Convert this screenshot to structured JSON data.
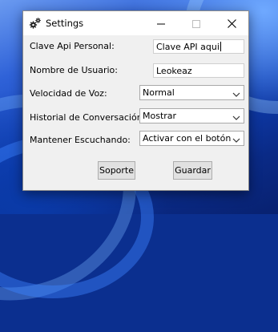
{
  "window": {
    "title": "Settings"
  },
  "fields": {
    "api_key": {
      "label": "Clave Api Personal:",
      "value": "Clave API aqui"
    },
    "username": {
      "label": "Nombre de Usuario:",
      "value": "Leokeaz"
    },
    "voice_speed": {
      "label": "Velocidad de Voz:",
      "selected": "Normal"
    },
    "history": {
      "label": "Historial de Conversación:",
      "selected": "Mostrar"
    },
    "keep_listening": {
      "label": "Mantener Escuchando:",
      "selected": "Activar con el botón"
    }
  },
  "buttons": {
    "support": "Soporte",
    "save": "Guardar"
  },
  "icons": {
    "app": "gears-icon",
    "minimize": "minimize-icon",
    "maximize": "maximize-icon",
    "close": "close-icon",
    "dropdown": "chevron-down-icon"
  }
}
